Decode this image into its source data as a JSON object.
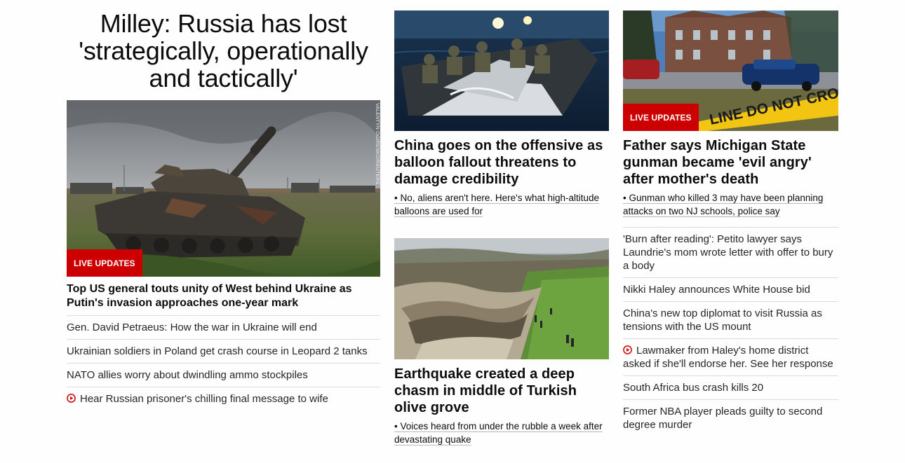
{
  "col1": {
    "headline": "Milley: Russia has lost 'strategically, operationally and tactically'",
    "image_credit": "VALENTYN OGIRENKO/REUTERS",
    "badge": "LIVE UPDATES",
    "lead_headline": "Top US general touts unity of West behind Ukraine as Putin's invasion approaches one-year mark",
    "items": [
      {
        "text": "Gen. David Petraeus: How the war in Ukraine will end",
        "video": false
      },
      {
        "text": "Ukrainian soldiers in Poland get crash course in Leopard 2 tanks",
        "video": false
      },
      {
        "text": "NATO allies worry about dwindling ammo stockpiles",
        "video": false
      },
      {
        "text": "Hear Russian prisoner's chilling final message to wife",
        "video": true
      }
    ]
  },
  "col2": {
    "card1": {
      "headline": "China goes on the offensive as balloon fallout threatens to damage credibility",
      "sub": "• No, aliens aren't here. Here's what high-altitude balloons are used for"
    },
    "card2": {
      "headline": "Earthquake created a deep chasm in middle of Turkish olive grove",
      "sub": "• Voices heard from under the rubble a week after devastating quake"
    }
  },
  "col3": {
    "badge": "LIVE UPDATES",
    "image_text": "LINE DO NOT CROSS",
    "headline": "Father says Michigan State gunman became 'evil angry' after mother's death",
    "sub": "• Gunman who killed 3 may have been planning attacks on two NJ schools, police say",
    "items": [
      {
        "text": "'Burn after reading': Petito lawyer says Laundrie's mom wrote letter with offer to bury a body",
        "video": false
      },
      {
        "text": "Nikki Haley announces White House bid",
        "video": false
      },
      {
        "text": "China's new top diplomat to visit Russia as tensions with the US mount",
        "video": false
      },
      {
        "text": "Lawmaker from Haley's home district asked if she'll endorse her. See her response",
        "video": true
      },
      {
        "text": "South Africa bus crash kills 20",
        "video": false
      },
      {
        "text": "Former NBA player pleads guilty to second degree murder",
        "video": false
      }
    ]
  },
  "colors": {
    "accent_red": "#cc0000",
    "divider": "#dcdcdc",
    "text": "#0c0c0c"
  },
  "icons": {
    "video": "play-circle-icon"
  }
}
